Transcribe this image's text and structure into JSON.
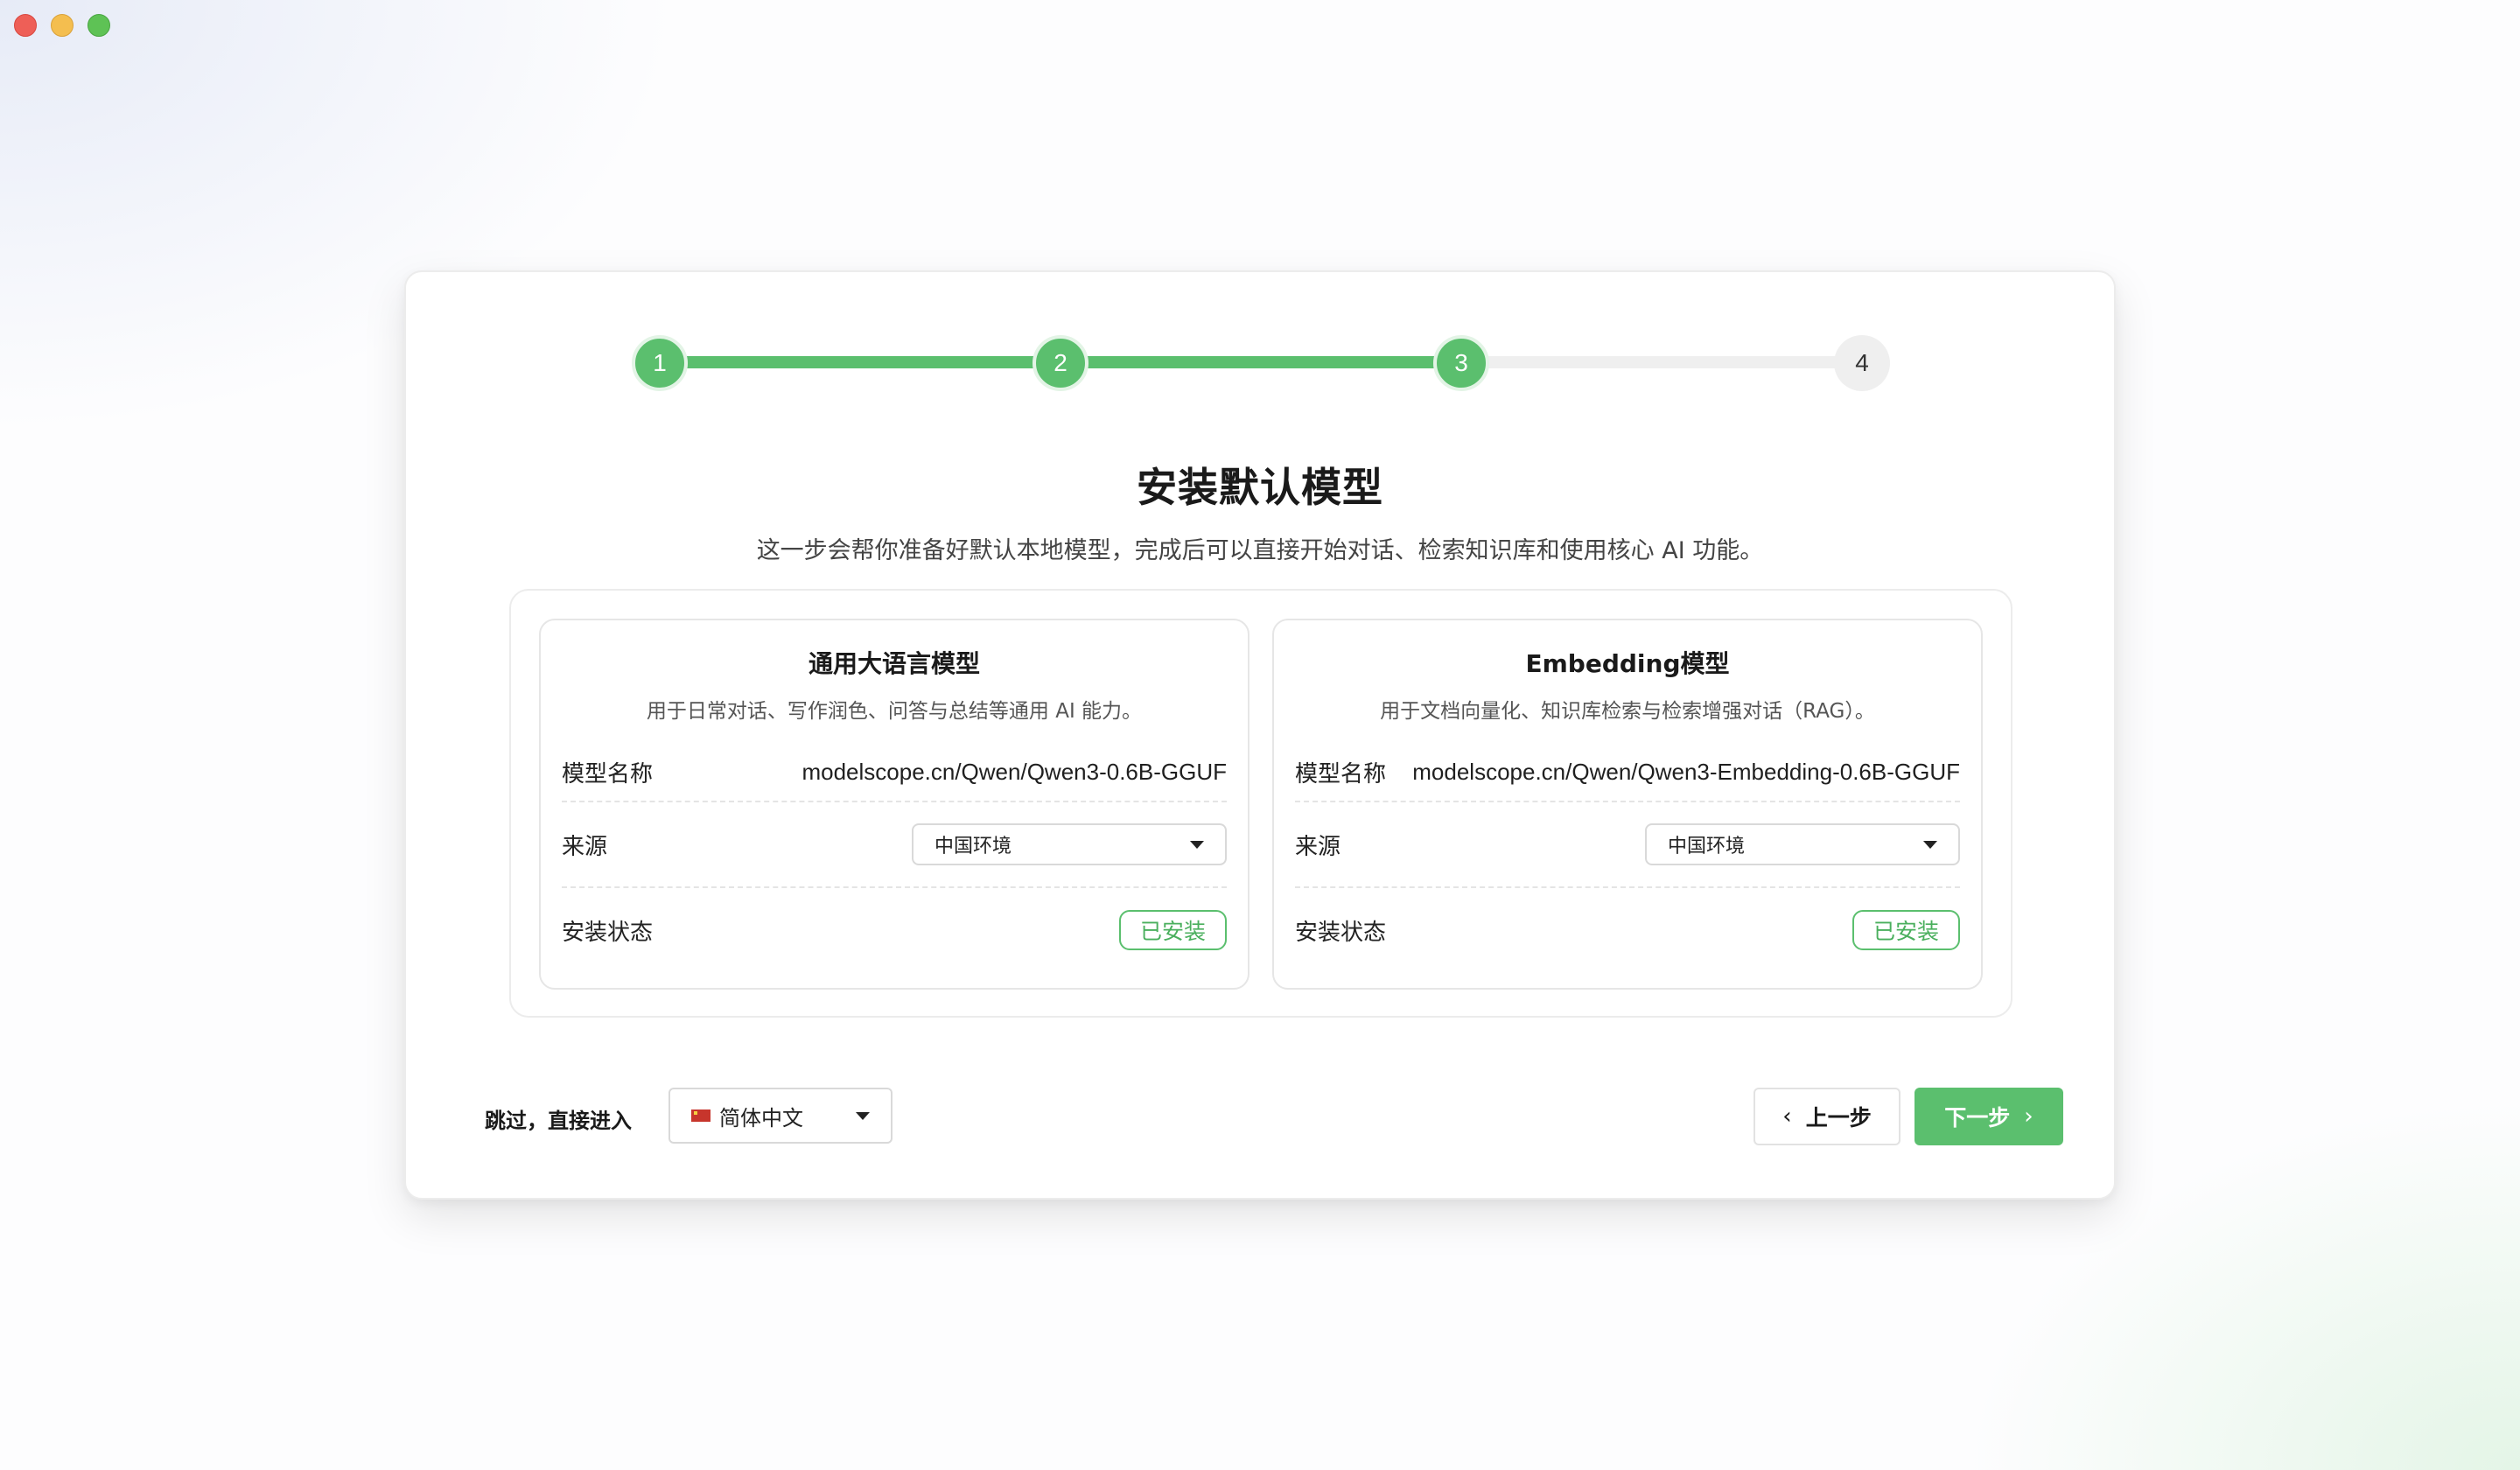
{
  "window": {
    "controls": [
      "close",
      "minimize",
      "maximize"
    ]
  },
  "stepper": {
    "steps": [
      "1",
      "2",
      "3",
      "4"
    ],
    "current": 3,
    "colors": {
      "done": "#5bbf6e",
      "todo": "#efefef"
    }
  },
  "header": {
    "title": "安装默认模型",
    "subtitle": "这一步会帮你准备好默认本地模型，完成后可以直接开始对话、检索知识库和使用核心 AI 功能。"
  },
  "models": [
    {
      "title": "通用大语言模型",
      "description": "用于日常对话、写作润色、问答与总结等通用 AI 能力。",
      "name_label": "模型名称",
      "name_value": "modelscope.cn/Qwen/Qwen3-0.6B-GGUF",
      "source_label": "来源",
      "source_value": "中国环境",
      "status_label": "安装状态",
      "status_value": "已安装"
    },
    {
      "title": "Embedding模型",
      "description": "用于文档向量化、知识库检索与检索增强对话（RAG）。",
      "name_label": "模型名称",
      "name_value": "modelscope.cn/Qwen/Qwen3-Embedding-0.6B-GGUF",
      "source_label": "来源",
      "source_value": "中国环境",
      "status_label": "安装状态",
      "status_value": "已安装"
    }
  ],
  "footer": {
    "skip_label": "跳过，直接进入",
    "language_value": "简体中文",
    "language_flag_icon": "china-flag-icon",
    "prev_label": "上一步",
    "next_label": "下一步"
  },
  "colors": {
    "accent": "#5bbf6e",
    "border": "#ececec"
  }
}
